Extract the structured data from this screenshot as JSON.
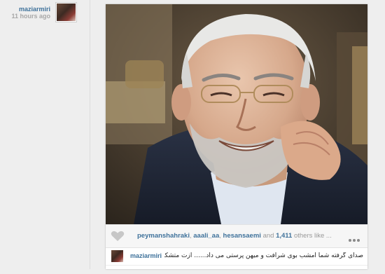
{
  "post": {
    "username": "maziarmiri",
    "time": "11 hours ago"
  },
  "likes": {
    "user1": "peymanshahraki",
    "user2": "aaali_aa",
    "user3": "hesansaemi",
    "and_text": "and",
    "count": "1,411",
    "others": "others like ..."
  },
  "comment": {
    "username": "maziarmiri",
    "text": "صدای گرفته شما امشب بوی شرافت و میهن پرستی می داد...... ازت متشکریم"
  },
  "icons": {
    "like": "heart-icon",
    "more": "ellipsis-icon"
  },
  "colors": {
    "username_blue": "#3f729b",
    "time_gray": "#a8a8a8",
    "background": "#eeeeee"
  }
}
